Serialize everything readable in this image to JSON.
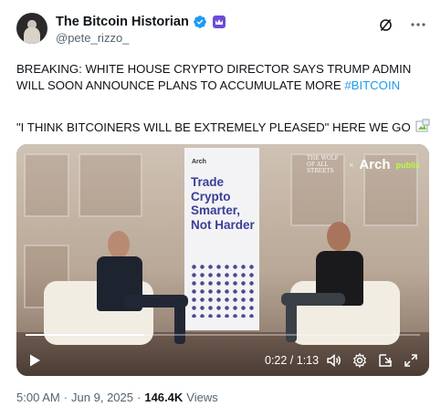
{
  "author": {
    "display_name": "The Bitcoin Historian",
    "handle": "@pete_rizzo_",
    "verified_color": "#1d9bf0",
    "affiliate_badge_color": "#6d4cd9"
  },
  "header_actions": [
    "grok-icon",
    "more-icon"
  ],
  "tweet": {
    "text_main": "BREAKING: WHITE HOUSE CRYPTO DIRECTOR SAYS TRUMP ADMIN WILL SOON ANNOUNCE PLANS TO ACCUMULATE MORE ",
    "hashtag": "#BITCOIN",
    "quote_line": "\"I THINK BITCOINERS WILL BE EXTREMELY PLEASED\" HERE WE GO"
  },
  "video": {
    "banner_brand": "Arch",
    "banner_slogan": "Trade Crypto Smarter, Not Harder",
    "logo_wolf": "THE WOLF OF ALL STREETS",
    "logo_x": "×",
    "logo_arch": "Arch",
    "logo_public": "public",
    "timecode": "0:22 / 1:13",
    "progress_fraction": 0.3
  },
  "footer": {
    "time": "5:00 AM",
    "separator": "·",
    "date": "Jun 9, 2025",
    "views_count": "146.4K",
    "views_label": "Views"
  },
  "colors": {
    "link": "#1d9bf0",
    "muted": "#536471",
    "text": "#0f1419"
  }
}
